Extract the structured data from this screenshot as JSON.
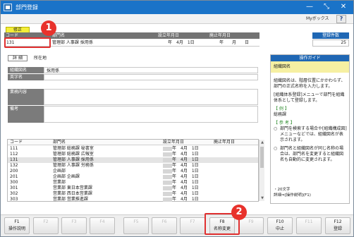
{
  "window": {
    "title": "部門登録",
    "minimize_glyph": "—",
    "maximize_glyph": "⤡",
    "close_glyph": "✕"
  },
  "toolbar": {
    "mybox_label": "Myボックス",
    "help_label": "?"
  },
  "mode_badge": "修正",
  "header": {
    "columns": [
      "コード",
      "部門名",
      "設立年月日",
      "廃止年月日"
    ],
    "values": {
      "code": "131",
      "name": "管理部 人事課 採用係",
      "established": "年　4月　1日",
      "abolished": "年　　月　　日"
    }
  },
  "registered_count": {
    "label": "登録件数",
    "value": "25"
  },
  "callouts": [
    "1",
    "2"
  ],
  "detail": {
    "tab_label": "詳 細",
    "location_label": "所在地",
    "fields": [
      {
        "label": "組織図名",
        "value": "採用係"
      },
      {
        "label": "英字名",
        "value": ""
      },
      {
        "label": "業務内容",
        "value": ""
      },
      {
        "label": "備考",
        "value": ""
      }
    ]
  },
  "list": {
    "columns": [
      "コード",
      "部門名",
      "設立年月日",
      "廃止年月日"
    ],
    "rows": [
      {
        "code": "111",
        "name": "管理部 総務課 秘書室",
        "date": "年　4月　1日",
        "abolished": ""
      },
      {
        "code": "112",
        "name": "管理部 総務課 広報室",
        "date": "年　4月　1日",
        "abolished": ""
      },
      {
        "code": "131",
        "name": "管理部 人事課 採用係",
        "date": "年　4月　1日",
        "abolished": ""
      },
      {
        "code": "132",
        "name": "管理部 人事課 労務係",
        "date": "年　4月　1日",
        "abolished": ""
      },
      {
        "code": "200",
        "name": "企画部",
        "date": "年　4月　1日",
        "abolished": ""
      },
      {
        "code": "201",
        "name": "企画部 企画課",
        "date": "年　4月　1日",
        "abolished": ""
      },
      {
        "code": "300",
        "name": "営業部",
        "date": "年　4月　1日",
        "abolished": ""
      },
      {
        "code": "301",
        "name": "営業部 東日本営業課",
        "date": "年　4月　1日",
        "abolished": ""
      },
      {
        "code": "302",
        "name": "営業部 西日本営業課",
        "date": "年　4月　1日",
        "abolished": ""
      },
      {
        "code": "303",
        "name": "営業部 営業推進課",
        "date": "年　4月　1日",
        "abolished": ""
      }
    ],
    "selected_index": 2
  },
  "guide": {
    "title": "操作ガイド",
    "heading": "組織図名",
    "paragraphs": [
      "組織図名は、階層位置にかかわらず、部門の正式名称を入力します。",
      "[組織体系登録]メニューで部門を組織体系として登録します。"
    ],
    "example_label": "【 例 】",
    "example_value": "総務課",
    "reference_label": "【 参 考 】",
    "bullets": [
      "部門を検索する場合や[組織構成図]メニューなどでは、組織図名が表示されます。",
      "部門名と組織図名が同じ名称の場合は、部門名を変更すると組織図名も自動的に変更されます。"
    ],
    "footer_limit": "・20文字",
    "footer_detail": "詳細⇒[操作説明](F1)"
  },
  "fkeys": [
    {
      "key": "F1",
      "label": "操作説明",
      "enabled": true
    },
    {
      "key": "F2",
      "label": "",
      "enabled": false
    },
    {
      "key": "F3",
      "label": "",
      "enabled": false
    },
    {
      "key": "F4",
      "label": "",
      "enabled": false
    },
    {
      "key": "F5",
      "label": "",
      "enabled": false
    },
    {
      "key": "F6",
      "label": "",
      "enabled": false
    },
    {
      "key": "F7",
      "label": "",
      "enabled": false
    },
    {
      "key": "F8",
      "label": "名称変更",
      "enabled": true
    },
    {
      "key": "F9",
      "label": "",
      "enabled": false
    },
    {
      "key": "F10",
      "label": "中止",
      "enabled": true
    },
    {
      "key": "F11",
      "label": "",
      "enabled": false
    },
    {
      "key": "F12",
      "label": "登録",
      "enabled": true
    }
  ],
  "colors": {
    "titlebar": "#1a73c8",
    "mode_badge": "#f4ee38",
    "callout": "#e8322c",
    "guide_header": "#1f67b4"
  }
}
